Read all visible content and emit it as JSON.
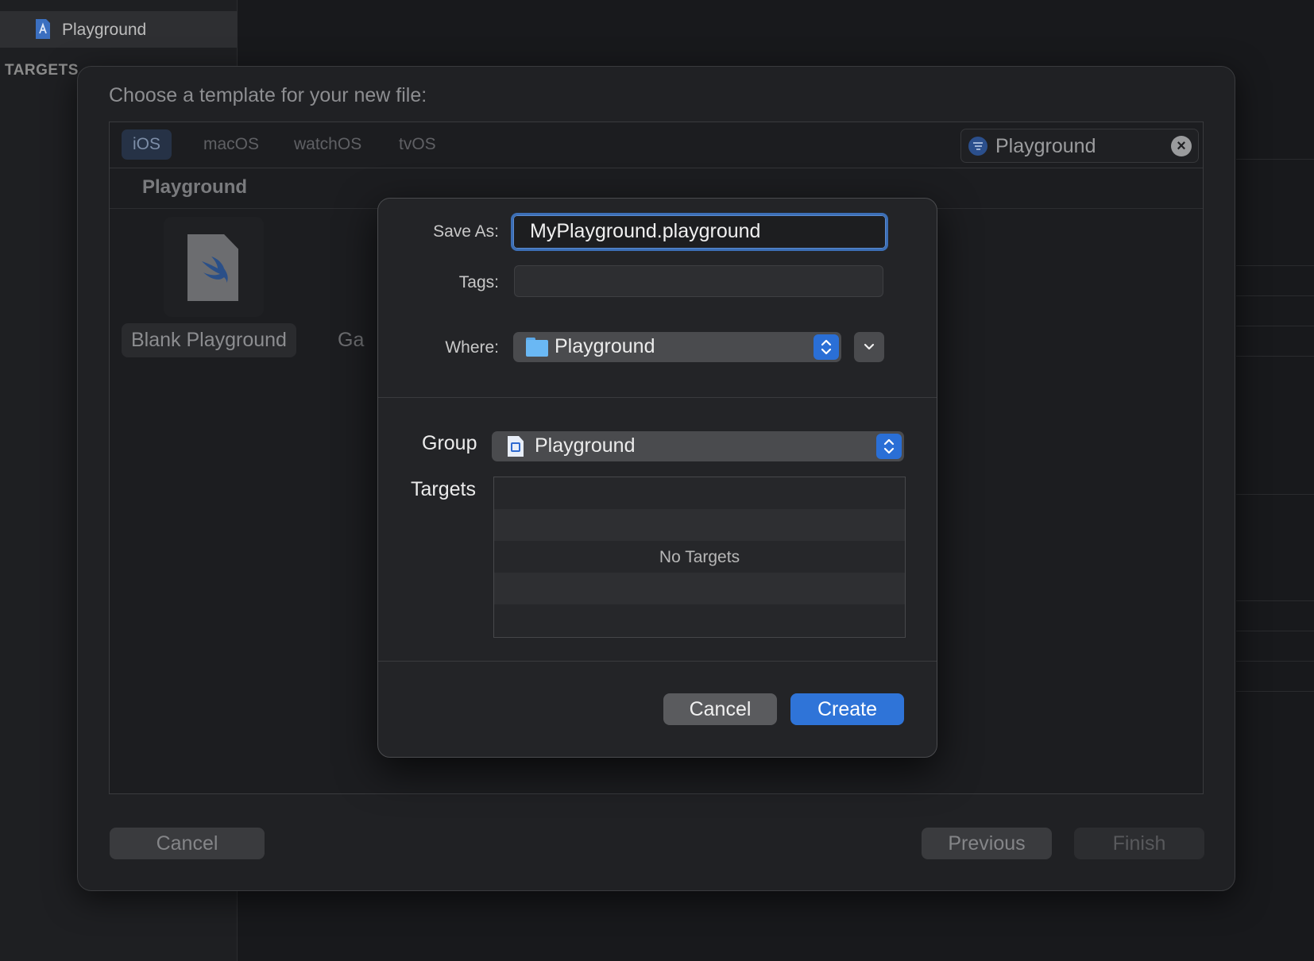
{
  "background": {
    "sidebar_item": "Playground",
    "targets_header": "TARGETS"
  },
  "template_sheet": {
    "title": "Choose a template for your new file:",
    "platform_tabs": [
      "iOS",
      "macOS",
      "watchOS",
      "tvOS"
    ],
    "selected_tab": "iOS",
    "filter_value": "Playground",
    "section_header": "Playground",
    "templates": [
      "Blank Playground",
      "Ga"
    ],
    "cancel_label": "Cancel",
    "previous_label": "Previous",
    "finish_label": "Finish"
  },
  "save_panel": {
    "save_as_label": "Save As:",
    "save_as_value": "MyPlayground.playground",
    "tags_label": "Tags:",
    "tags_value": "",
    "where_label": "Where:",
    "where_value": "Playground",
    "group_label": "Group",
    "group_value": "Playground",
    "targets_label": "Targets",
    "targets_empty": "No Targets",
    "cancel_label": "Cancel",
    "create_label": "Create"
  },
  "colors": {
    "accent": "#2f74d8",
    "focus_ring": "#3c6fb6",
    "folder": "#6ab8f4"
  },
  "icons": [
    "project-file-icon",
    "swift-icon",
    "filter-icon",
    "clear-icon",
    "folder-icon",
    "stepper-icon",
    "disclosure-chevron-icon"
  ]
}
